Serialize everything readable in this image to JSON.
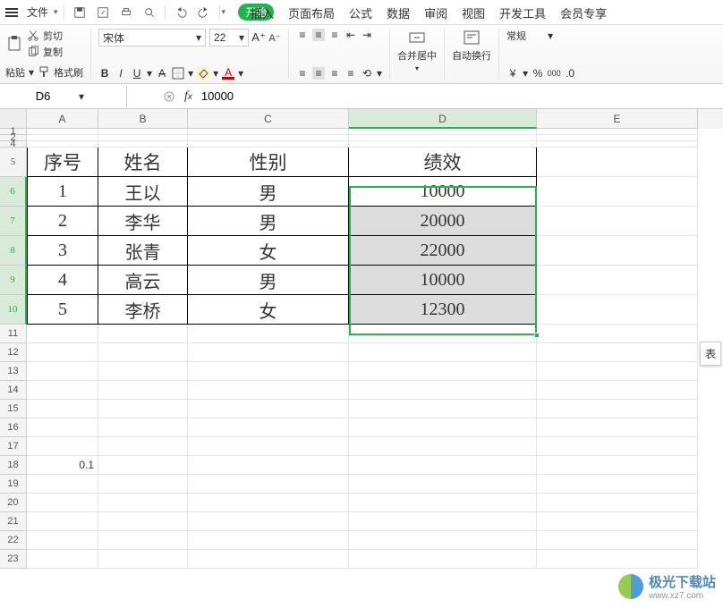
{
  "menu": {
    "file": "文件",
    "start": "开始",
    "tabs": [
      "插入",
      "页面布局",
      "公式",
      "数据",
      "审阅",
      "视图",
      "开发工具",
      "会员专享"
    ]
  },
  "ribbon": {
    "cut": "剪切",
    "copy": "复制",
    "paste": "粘贴",
    "formatpainter": "格式刷",
    "fontname": "宋体",
    "fontsize": "22",
    "merge": "合并居中",
    "autowrap": "自动换行",
    "numgroup": "常规"
  },
  "formula": {
    "cellref": "D6",
    "value": "10000"
  },
  "cols": [
    "A",
    "B",
    "C",
    "D",
    "E"
  ],
  "headers": {
    "A": "序号",
    "B": "姓名",
    "C": "性别",
    "D": "绩效"
  },
  "datarows": [
    {
      "A": "1",
      "B": "王以",
      "C": "男",
      "D": "10000"
    },
    {
      "A": "2",
      "B": "李华",
      "C": "男",
      "D": "20000"
    },
    {
      "A": "3",
      "B": "张青",
      "C": "女",
      "D": "22000"
    },
    {
      "A": "4",
      "B": "高云",
      "C": "男",
      "D": "10000"
    },
    {
      "A": "5",
      "B": "李桥",
      "C": "女",
      "D": "12300"
    }
  ],
  "r18A": "0.1",
  "selection": {
    "ref": "D6:D10",
    "active": "D6"
  },
  "floatlabel": "表",
  "watermark": {
    "name": "极光下载站",
    "url": "www.xz7.com"
  }
}
